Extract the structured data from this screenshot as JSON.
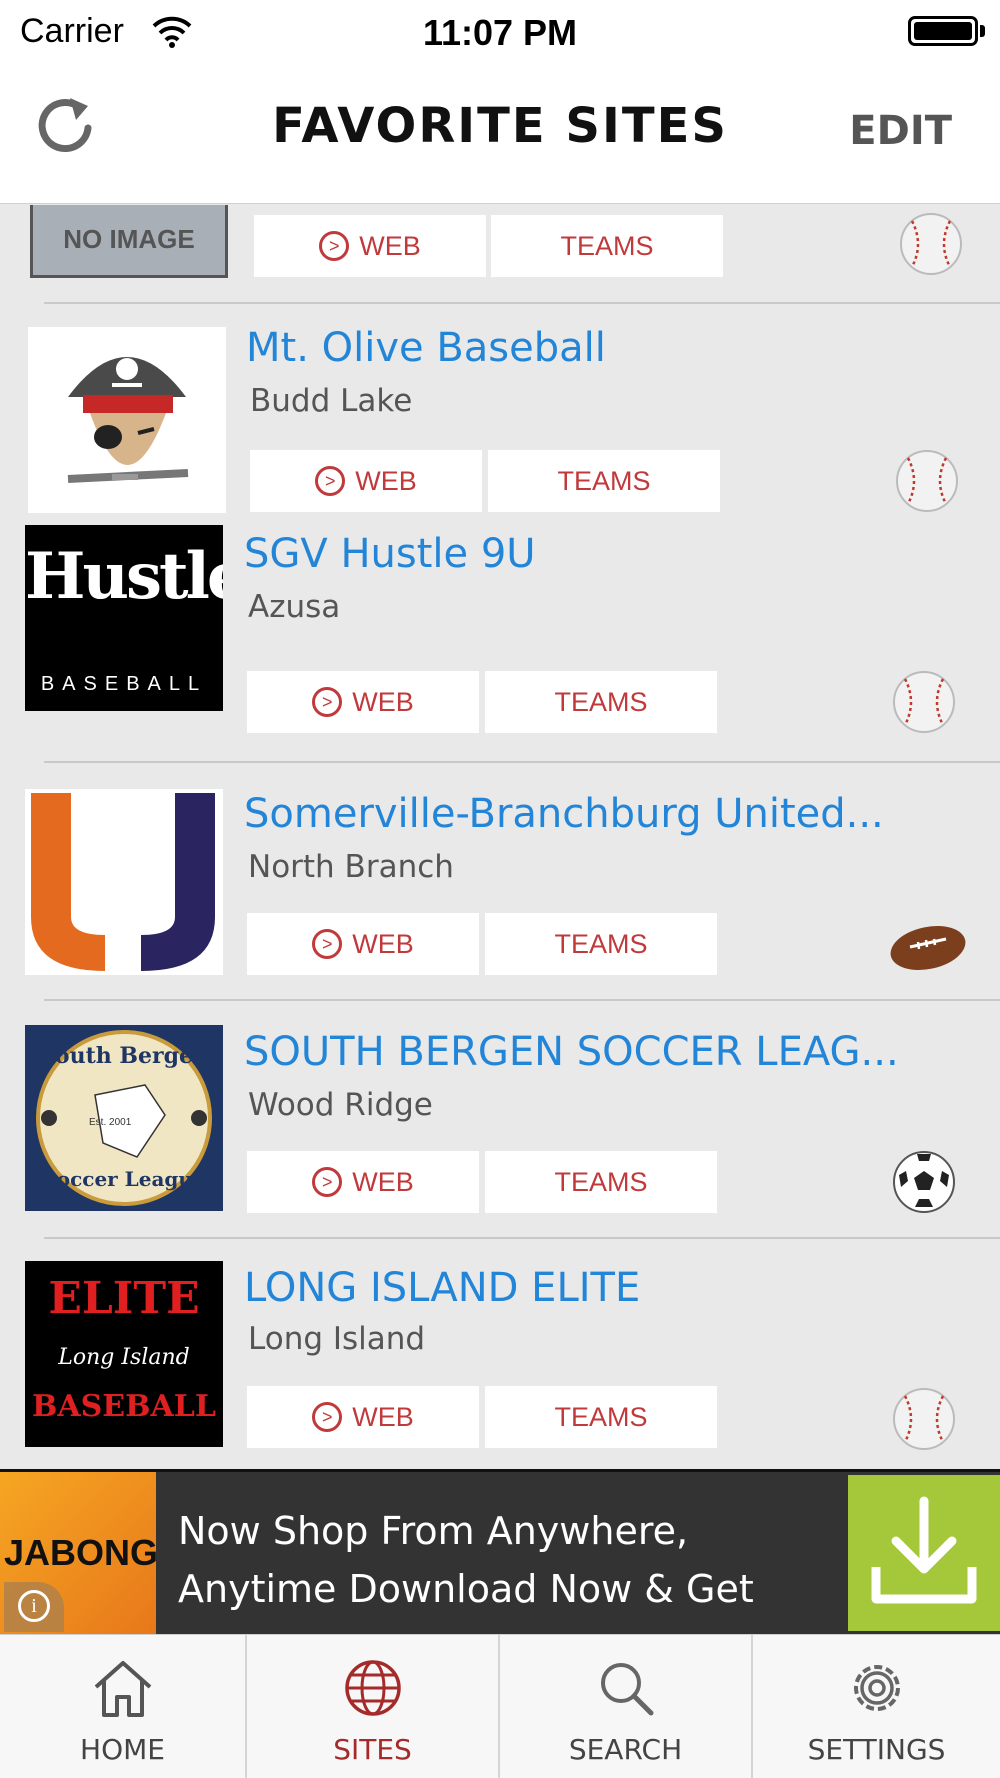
{
  "status_bar": {
    "carrier": "Carrier",
    "time": "11:07 PM"
  },
  "header": {
    "title": "FAVORITE SITES",
    "edit_label": "EDIT"
  },
  "buttons": {
    "web": "WEB",
    "teams": "TEAMS"
  },
  "partial_item": {
    "logo_text": "NO IMAGE",
    "sport_icon": "baseball-icon"
  },
  "sites": [
    {
      "name": "Mt. Olive Baseball",
      "location": "Budd Lake",
      "sport_icon": "baseball-icon"
    },
    {
      "name": "SGV Hustle 9U",
      "location": "Azusa",
      "sport_icon": "baseball-icon",
      "logo_text": "Hustle",
      "logo_subtext": "BASEBALL"
    },
    {
      "name": "Somerville-Branchburg United...",
      "location": "North Branch",
      "sport_icon": "football-icon"
    },
    {
      "name": "SOUTH BERGEN SOCCER LEAG...",
      "location": "Wood Ridge",
      "sport_icon": "soccer-ball-icon",
      "logo_text_top": "South Bergen",
      "logo_text_bottom": "Soccer League",
      "logo_est": "Est. 2001"
    },
    {
      "name": "LONG ISLAND ELITE",
      "location": "Long Island",
      "sport_icon": "baseball-icon",
      "logo_text_top": "ELITE",
      "logo_text_mid": "Long Island",
      "logo_text_bottom": "BASEBALL"
    }
  ],
  "ad": {
    "brand": "JABONG",
    "line1": "Now Shop From Anywhere,",
    "line2": "Anytime Download Now & Get"
  },
  "tabs": [
    {
      "label": "HOME",
      "icon": "home-icon",
      "active": false
    },
    {
      "label": "SITES",
      "icon": "globe-icon",
      "active": true
    },
    {
      "label": "SEARCH",
      "icon": "search-icon",
      "active": false
    },
    {
      "label": "SETTINGS",
      "icon": "gear-icon",
      "active": false
    }
  ],
  "colors": {
    "accent": "#a52a2a",
    "link": "#2285d8",
    "button_text": "#c0393b",
    "ad_green": "#a5c73a"
  }
}
